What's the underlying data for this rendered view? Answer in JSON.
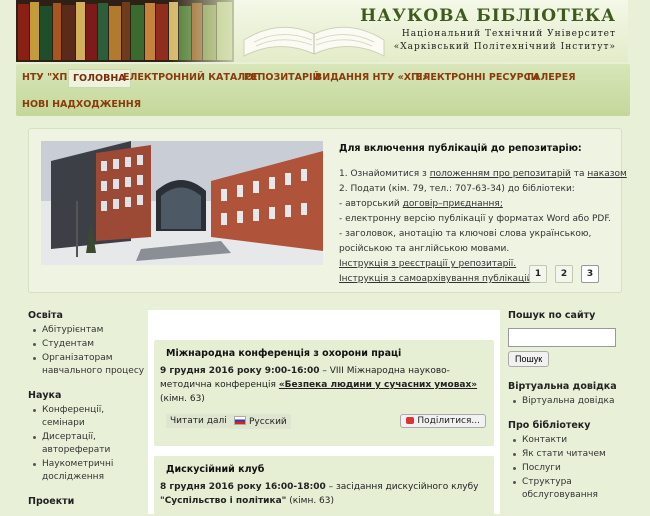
{
  "header": {
    "title": "НАУКОВА БІБЛІОТЕКА",
    "subtitle1": "Національний Технічний Університет",
    "subtitle2": "«Харківський Політехнічний Інститут»"
  },
  "nav": {
    "items": [
      "НТУ \"ХПІ\"",
      "ГОЛОВНА",
      "ЕЛЕКТРОННИЙ КАТАЛОГ",
      "РЕПОЗИТАРІЙ",
      "ВИДАННЯ НТУ «ХПІ»",
      "ЕЛЕКТРОННІ РЕСУРСИ",
      "ГАЛЕРЕЯ",
      "НОВІ НАДХОДЖЕННЯ"
    ],
    "active_index": 1
  },
  "slider": {
    "title": "Для включення публікацій до репозитарію:",
    "line1_pre": "1. Ознайомитися з ",
    "line1_link1": "положенням про репозитарій",
    "line1_mid": " та ",
    "line1_link2": "наказом",
    "line2": "2. Подати (кім. 79, тел.: 707-63-34) до бібліотеки:",
    "line3_pre": "- авторський ",
    "line3_link": "договір–приєднання;",
    "line4": "- електронну версію публікації у форматах Word або PDF.",
    "line5": "- заголовок, анотацію та ключові слова українською,",
    "line6": "російською та англійською мовами.",
    "link_registration": "Інструкція з реєстрації у репозитарії.",
    "link_selfarchive": "Інструкція з самоархівування публікацій.",
    "pages": [
      "1",
      "2",
      "3"
    ],
    "active_page": 3
  },
  "left_sidebar": {
    "sections": [
      {
        "title": "Освіта",
        "items": [
          "Абітурієнтам",
          "Студентам",
          "Організаторам навчального процесу"
        ]
      },
      {
        "title": "Наука",
        "items": [
          "Конференції, семінари",
          "Дисертації, автореферати",
          "Наукометричні дослідження"
        ]
      },
      {
        "title": "Проекти",
        "items": []
      }
    ]
  },
  "news": [
    {
      "title": "Міжнародна конференція з охорони праці",
      "date": "9 грудня 2016 року 9:00-16:00",
      "text_pre": " – VIII Міжнародна науково-методична конференція ",
      "event": "«Безпека людини у сучасних умовах»",
      "text_post": " (кімн. 63)",
      "read_more": "Читати далі",
      "language": "Русский",
      "share": "Поділитися..."
    },
    {
      "title": "Дискусійний клуб",
      "date": "8 грудня 2016 року 16:00-18:00",
      "text_pre": " – засідання дискусійного клубу ",
      "event": "\"Суспільство і політика\"",
      "text_post": " (кімн. 63)"
    }
  ],
  "right_sidebar": {
    "search_title": "Пошук по сайту",
    "search_value": "",
    "search_button": "Пошук",
    "sections": [
      {
        "title": "Віртуальна довідка",
        "items": [
          "Віртуальна довідка"
        ]
      },
      {
        "title": "Про бібліотеку",
        "items": [
          "Контакти",
          "Як стати читачем",
          "Послуги",
          "Структура обслуговування"
        ]
      }
    ]
  }
}
